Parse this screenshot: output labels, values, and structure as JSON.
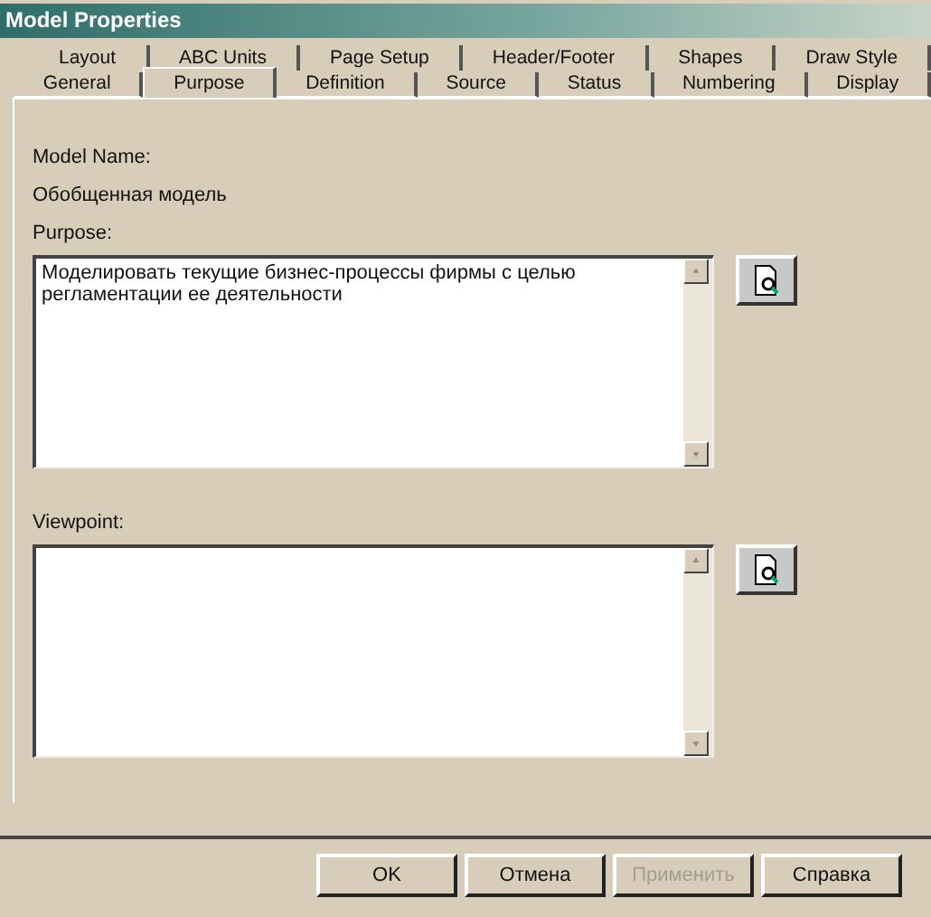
{
  "window": {
    "title": "Model Properties"
  },
  "tab_rows": [
    {
      "tabs": [
        {
          "label": "Layout",
          "selected": false
        },
        {
          "label": "ABC Units",
          "selected": false
        },
        {
          "label": "Page Setup",
          "selected": false
        },
        {
          "label": "Header/Footer",
          "selected": false
        },
        {
          "label": "Shapes",
          "selected": false
        },
        {
          "label": "Draw Style",
          "selected": false
        }
      ]
    },
    {
      "tabs": [
        {
          "label": "General",
          "selected": false
        },
        {
          "label": "Purpose",
          "selected": true
        },
        {
          "label": "Definition",
          "selected": false
        },
        {
          "label": "Source",
          "selected": false
        },
        {
          "label": "Status",
          "selected": false
        },
        {
          "label": "Numbering",
          "selected": false
        },
        {
          "label": "Display",
          "selected": false
        }
      ]
    }
  ],
  "model_name": {
    "label": "Model Name:",
    "value": "Обобщенная модель"
  },
  "fields": [
    {
      "label": "Purpose:",
      "value": "Моделировать текущие бизнес-процессы фирмы с целью регламентации ее деятельности"
    },
    {
      "label": "Viewpoint:"
    }
  ],
  "buttons": [
    {
      "label": "OK",
      "disabled": false
    },
    {
      "label": "Отмена",
      "disabled": false
    },
    {
      "label": "Применить",
      "disabled": true
    },
    {
      "label": "Справка",
      "disabled": false
    }
  ]
}
